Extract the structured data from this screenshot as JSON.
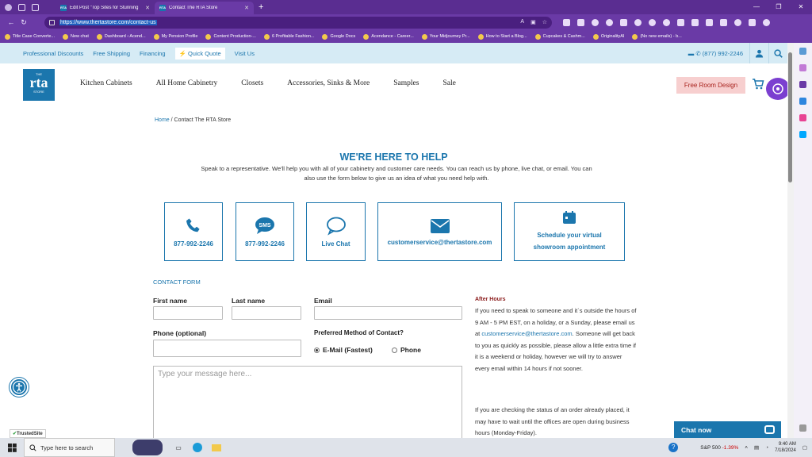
{
  "browser": {
    "tabs": [
      {
        "label": "Edit Post \"Top Sites for Stunning",
        "favicon": "rta"
      },
      {
        "label": "Contact The RTA Store",
        "favicon": "rta"
      }
    ],
    "url": "https://www.thertastore.com/contact-us",
    "bookmarks": [
      "Title Case Converte...",
      "New chat",
      "Dashboard ‹ Acend...",
      "My Pension Profile",
      "Content Production-...",
      "6 Profitable Fashion...",
      "Google Docs",
      "Acendance - Career...",
      "Your Midjourney Pr...",
      "How to Start a Blog...",
      "Cupcakes & Cashm...",
      "OriginalityAI",
      "(No new emails) - b..."
    ]
  },
  "utility": {
    "links": [
      "Professional Discounts",
      "Free Shipping",
      "Financing"
    ],
    "quick_quote": "Quick Quote",
    "visit_us": "Visit Us",
    "phone": "(877) 992-2246"
  },
  "header": {
    "logo_small": "THE",
    "logo_main": "rta",
    "logo_bottom": "STORE",
    "nav": [
      "Kitchen Cabinets",
      "All Home Cabinetry",
      "Closets",
      "Accessories, Sinks & More",
      "Samples",
      "Sale"
    ],
    "cta": "Free Room Design"
  },
  "breadcrumb": {
    "home": "Home",
    "sep": " / ",
    "current": "Contact The RTA Store"
  },
  "hero": {
    "title": "WE'RE HERE TO HELP",
    "intro": "Speak to a representative. We'll help you with all of your cabinetry and customer care needs. You can reach us by phone, live chat, or email. You can also use the form below to give us an idea of what you need help with."
  },
  "contact_cards": [
    {
      "label": "877-992-2246",
      "icon": "phone-icon"
    },
    {
      "label": "877-992-2246",
      "icon": "sms-icon"
    },
    {
      "label": "Live Chat",
      "icon": "chat-icon"
    },
    {
      "label": "customerservice@thertastore.com",
      "icon": "envelope-icon"
    },
    {
      "label": "Schedule your virtual showroom appointment",
      "icon": "calendar-icon"
    }
  ],
  "form": {
    "title": "CONTACT FORM",
    "first_name": "First name",
    "last_name": "Last name",
    "email": "Email",
    "phone": "Phone (optional)",
    "preferred": "Preferred Method of Contact?",
    "opt_email": "E-Mail (Fastest)",
    "opt_phone": "Phone",
    "message_placeholder": "Type your message here..."
  },
  "after_hours": {
    "title": "After Hours",
    "p1_a": "If you need to speak to someone and it`s outside the hours of 9 AM - 5 PM EST, on a holiday, or a Sunday, please email us at ",
    "p1_link": "customerservice@thertastore.com",
    "p1_b": ". Someone will get back to you as quickly as possible, please allow a little extra time if it is a weekend or holiday, however we will try to answer every email within 14 hours if not sooner.",
    "p2": "If you are checking the status of an order already placed, it may have to wait until the offices are open during business hours (Monday-Friday)."
  },
  "widgets": {
    "trusted": "TrustedSite",
    "chat_now": "Chat now"
  },
  "taskbar": {
    "search_placeholder": "Type here to search",
    "stock_name": "S&P 500",
    "stock_change": "-1.39%",
    "time": "9:40 AM",
    "date": "7/18/2024"
  },
  "colors": {
    "brand_blue": "#1b76ad",
    "browser_purple": "#6a3aa6",
    "cta_bg": "#f7cfcf"
  }
}
